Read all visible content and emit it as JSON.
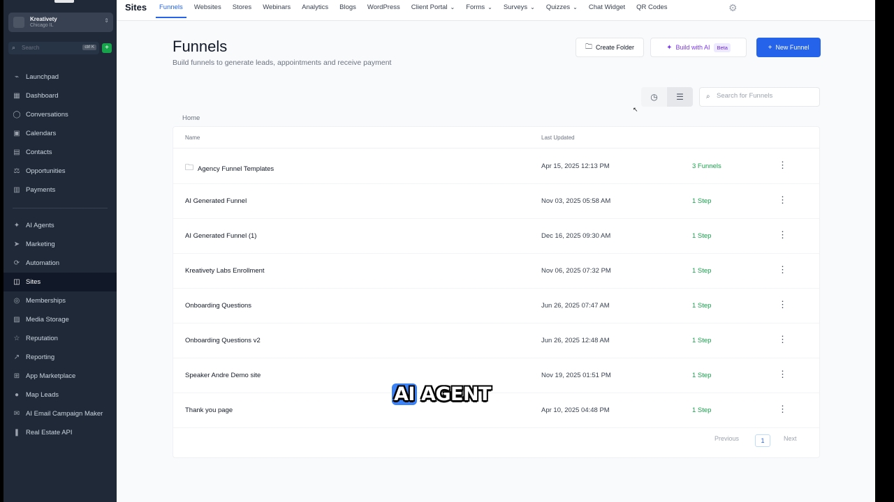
{
  "sidebar": {
    "account": {
      "name": "Kreativety",
      "location": "Chicago IL"
    },
    "search": {
      "placeholder": "Search",
      "shortcut": "ctrl K"
    },
    "items_top": [
      {
        "label": "Launchpad",
        "icon": "rocket-icon"
      },
      {
        "label": "Dashboard",
        "icon": "dashboard-icon"
      },
      {
        "label": "Conversations",
        "icon": "chat-icon"
      },
      {
        "label": "Calendars",
        "icon": "calendar-icon"
      },
      {
        "label": "Contacts",
        "icon": "contacts-icon"
      },
      {
        "label": "Opportunities",
        "icon": "opportunities-icon"
      },
      {
        "label": "Payments",
        "icon": "payments-icon"
      }
    ],
    "items_bottom": [
      {
        "label": "AI Agents",
        "icon": "ai-agents-icon"
      },
      {
        "label": "Marketing",
        "icon": "marketing-icon"
      },
      {
        "label": "Automation",
        "icon": "automation-icon"
      },
      {
        "label": "Sites",
        "icon": "sites-icon",
        "active": true
      },
      {
        "label": "Memberships",
        "icon": "memberships-icon"
      },
      {
        "label": "Media Storage",
        "icon": "media-icon"
      },
      {
        "label": "Reputation",
        "icon": "star-icon"
      },
      {
        "label": "Reporting",
        "icon": "reporting-icon"
      },
      {
        "label": "App Marketplace",
        "icon": "marketplace-icon"
      },
      {
        "label": "Map Leads",
        "icon": "map-pin-icon"
      },
      {
        "label": "AI Email Campaign Maker",
        "icon": "email-icon"
      },
      {
        "label": "Real Estate API",
        "icon": "bookmark-icon"
      }
    ]
  },
  "topbar": {
    "title": "Sites",
    "tabs": [
      {
        "label": "Funnels",
        "active": true
      },
      {
        "label": "Websites"
      },
      {
        "label": "Stores"
      },
      {
        "label": "Webinars"
      },
      {
        "label": "Analytics"
      },
      {
        "label": "Blogs"
      },
      {
        "label": "WordPress"
      },
      {
        "label": "Client Portal",
        "dropdown": true
      },
      {
        "label": "Forms",
        "dropdown": true
      },
      {
        "label": "Surveys",
        "dropdown": true
      },
      {
        "label": "Quizzes",
        "dropdown": true
      },
      {
        "label": "Chat Widget"
      },
      {
        "label": "QR Codes"
      }
    ]
  },
  "page": {
    "title": "Funnels",
    "subtitle": "Build funnels to generate leads, appointments and receive payment",
    "create_folder": "Create Folder",
    "build_ai": "Build with AI",
    "beta": "Beta",
    "new_funnel": "New Funnel",
    "search_placeholder": "Search for Funnels",
    "breadcrumb": "Home"
  },
  "table": {
    "headers": {
      "name": "Name",
      "updated": "Last Updated"
    },
    "rows": [
      {
        "name": "Agency Funnel Templates",
        "folder": true,
        "updated": "Apr 15, 2025 12:13 PM",
        "steps": "3 Funnels"
      },
      {
        "name": "AI Generated Funnel",
        "updated": "Nov 03, 2025 05:58 AM",
        "steps": "1 Step"
      },
      {
        "name": "AI Generated Funnel (1)",
        "updated": "Dec 16, 2025 09:30 AM",
        "steps": "1 Step"
      },
      {
        "name": "Kreativety Labs Enrollment",
        "updated": "Nov 06, 2025 07:32 PM",
        "steps": "1 Step"
      },
      {
        "name": "Onboarding Questions",
        "updated": "Jun 26, 2025 07:47 AM",
        "steps": "1 Step"
      },
      {
        "name": "Onboarding Questions v2",
        "updated": "Jun 26, 2025 12:48 AM",
        "steps": "1 Step"
      },
      {
        "name": "Speaker Andre Demo site",
        "updated": "Nov 19, 2025 01:51 PM",
        "steps": "1 Step"
      },
      {
        "name": "Thank you page",
        "updated": "Apr 10, 2025 04:48 PM",
        "steps": "1 Step"
      }
    ]
  },
  "pagination": {
    "previous": "Previous",
    "page": "1",
    "next": "Next"
  },
  "overlay": {
    "word1": "AI",
    "word2": "AGENT"
  },
  "colors": {
    "accent": "#2563eb",
    "sidebar": "#1f2937",
    "success": "#16a34a",
    "ai": "#7c3aed"
  }
}
